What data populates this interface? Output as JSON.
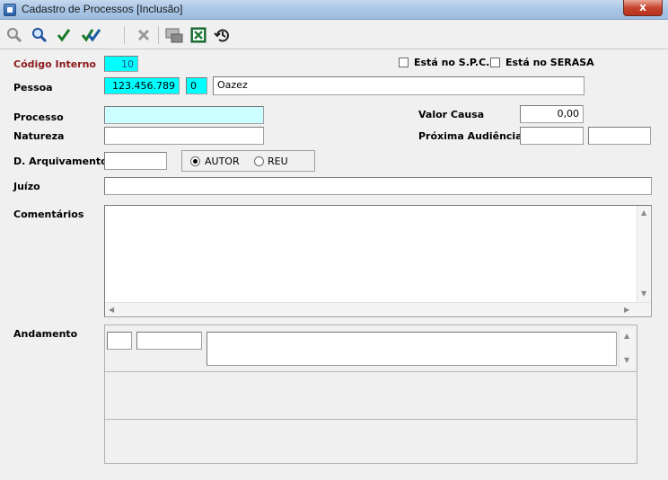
{
  "window": {
    "title": "Cadastro de Processos [Inclusão]",
    "close_label": "x"
  },
  "toolbar": {
    "buttons": [
      {
        "name": "zoom-out-search",
        "icon": "magnifier-gray-icon"
      },
      {
        "name": "search",
        "icon": "magnifier-icon"
      },
      {
        "name": "confirm",
        "icon": "check-icon"
      },
      {
        "name": "confirm-all",
        "icon": "double-check-icon"
      },
      {
        "name": "cancel",
        "icon": "x-icon"
      },
      {
        "name": "print",
        "icon": "printer-icon"
      },
      {
        "name": "excel",
        "icon": "excel-icon"
      },
      {
        "name": "history",
        "icon": "history-clock-icon"
      }
    ]
  },
  "form": {
    "codigo_interno": {
      "label": "Código Interno",
      "value": "10"
    },
    "pessoa": {
      "label": "Pessoa",
      "cpf": "123.456.789",
      "code": "0",
      "name": "Oazez"
    },
    "spc": {
      "label": "Está no S.P.C.",
      "checked": false
    },
    "serasa": {
      "label": "Está no SERASA",
      "checked": false
    },
    "processo": {
      "label": "Processo",
      "value": ""
    },
    "valor_causa": {
      "label": "Valor Causa",
      "value": "0,00"
    },
    "natureza": {
      "label": "Natureza",
      "value": ""
    },
    "proxima_audiencia": {
      "label": "Próxima Audiência",
      "date": "",
      "time": ""
    },
    "d_arquivamento": {
      "label": "D. Arquivamento",
      "value": ""
    },
    "parte": {
      "options": [
        "AUTOR",
        "REU"
      ],
      "selected": "AUTOR"
    },
    "juizo": {
      "label": "Juízo",
      "value": ""
    },
    "comentarios": {
      "label": "Comentários",
      "value": ""
    },
    "andamento": {
      "label": "Andamento",
      "field1": "",
      "field2": "",
      "text": ""
    }
  },
  "colors": {
    "label_red": "#8b1a1a",
    "highlight_cyan": "#00ffff",
    "light_cyan": "#ccffff"
  }
}
